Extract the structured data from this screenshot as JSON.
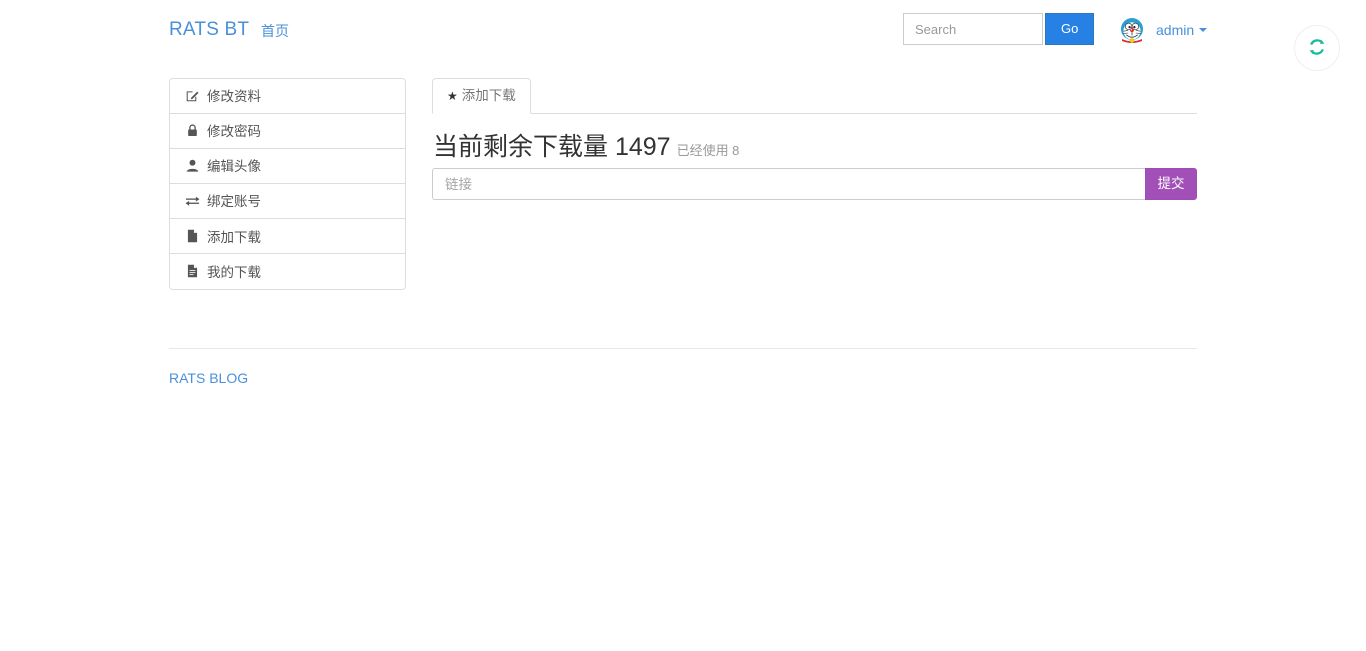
{
  "header": {
    "brand": "RATS BT",
    "home_link": "首页",
    "search": {
      "placeholder": "Search",
      "value": "",
      "go_label": "Go"
    },
    "user": {
      "name": "admin",
      "avatar_icon": "doraemon-avatar",
      "caret_icon": "caret-down-icon"
    },
    "refresh": {
      "icon": "refresh-icon",
      "color": "#1abc9c"
    }
  },
  "sidebar": {
    "items": [
      {
        "label": "修改资料",
        "icon": "edit-square-icon",
        "glyph": "✎"
      },
      {
        "label": "修改密码",
        "icon": "lock-icon",
        "glyph": "🔒"
      },
      {
        "label": "编辑头像",
        "icon": "user-icon",
        "glyph": "👤"
      },
      {
        "label": "绑定账号",
        "icon": "exchange-arrows-icon",
        "glyph": "⇄"
      },
      {
        "label": "添加下载",
        "icon": "file-icon",
        "glyph": "📄"
      },
      {
        "label": "我的下载",
        "icon": "file-text-icon",
        "glyph": "📃"
      }
    ]
  },
  "main": {
    "tab": {
      "label": "添加下载",
      "icon": "star-icon",
      "glyph": "★"
    },
    "usage": {
      "title": "当前剩余下载量 1497",
      "remaining_label": "当前剩余下载量",
      "remaining_count": "1497",
      "used_text": "已经使用 8",
      "used_label": "已经使用",
      "used_count": "8"
    },
    "form": {
      "url_placeholder": "链接",
      "url_value": "",
      "submit_label": "提交"
    }
  },
  "footer": {
    "link": "RATS BLOG"
  },
  "colors": {
    "brand_link": "#4a90d9",
    "go_button": "#2780e3",
    "submit_button": "#a24fb8",
    "refresh_icon": "#1abc9c",
    "border": "#dddddd"
  }
}
